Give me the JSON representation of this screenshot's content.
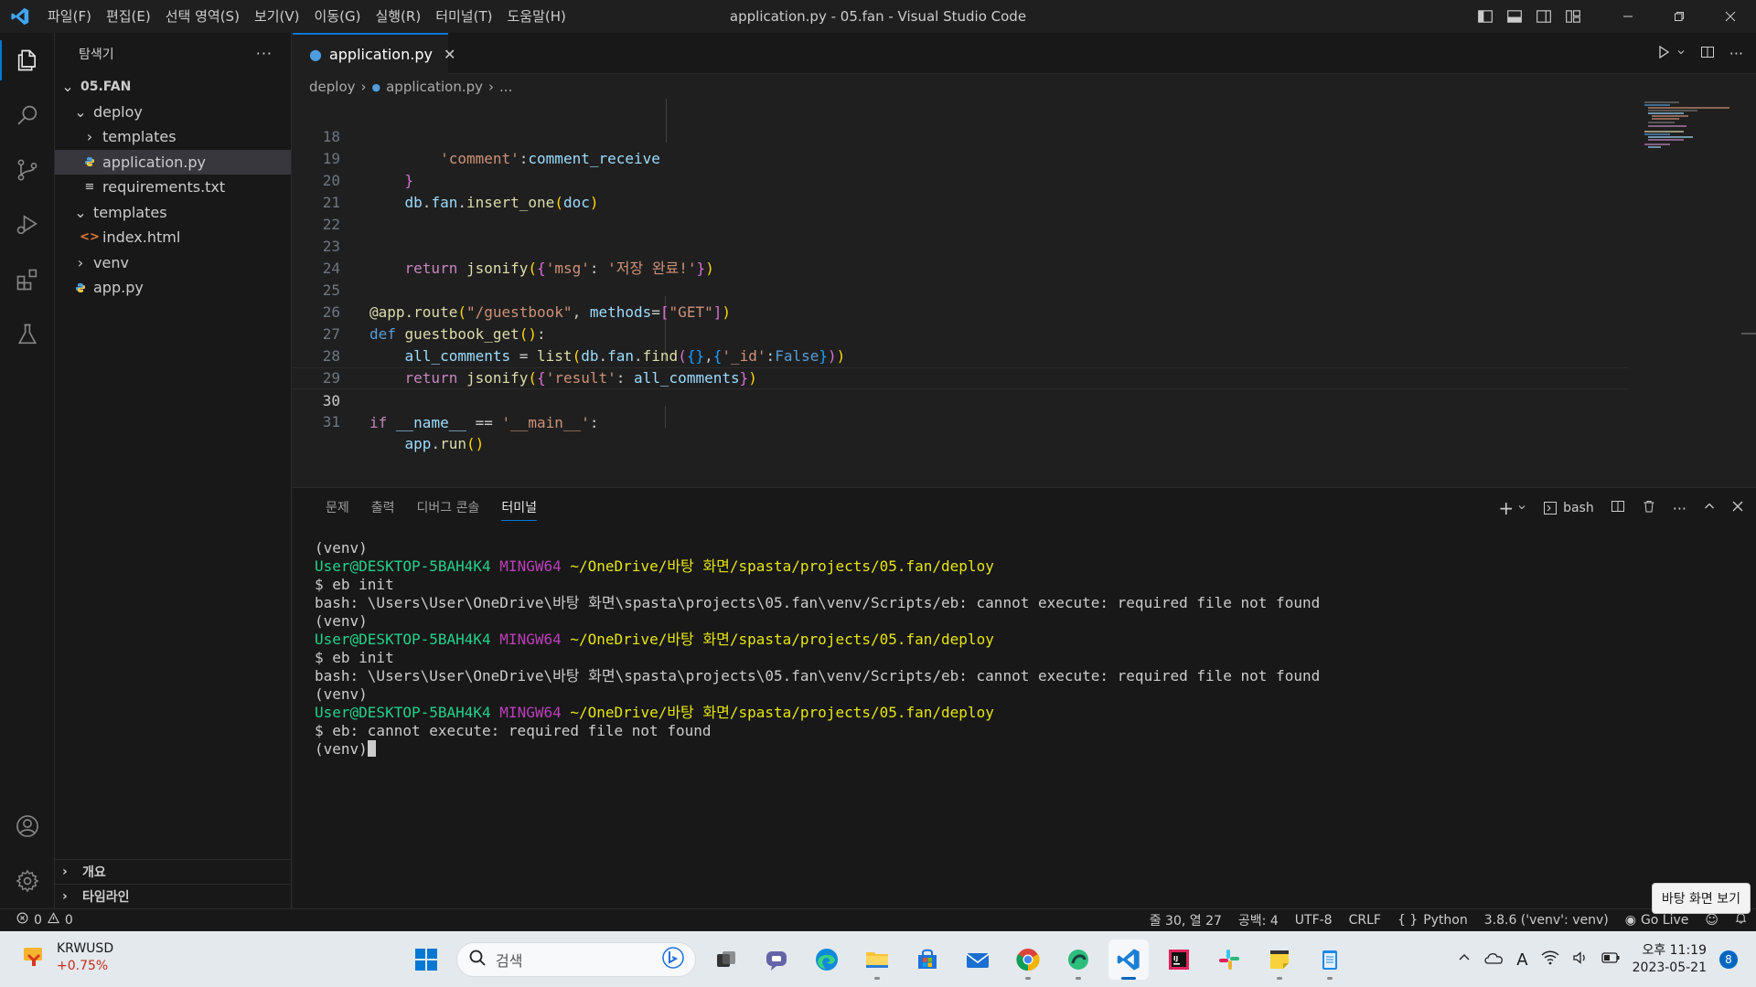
{
  "window": {
    "title": "application.py - 05.fan - Visual Studio Code",
    "menu": [
      "파일(F)",
      "편집(E)",
      "선택 영역(S)",
      "보기(V)",
      "이동(G)",
      "실행(R)",
      "터미널(T)",
      "도움말(H)"
    ]
  },
  "sidebar": {
    "title": "탐색기",
    "root": "05.FAN",
    "items": [
      {
        "label": "deploy",
        "kind": "folder-open",
        "depth": 1
      },
      {
        "label": "templates",
        "kind": "folder-closed",
        "depth": 2
      },
      {
        "label": "application.py",
        "kind": "python",
        "depth": 2
      },
      {
        "label": "requirements.txt",
        "kind": "text",
        "depth": 2
      },
      {
        "label": "templates",
        "kind": "folder-open",
        "depth": 1
      },
      {
        "label": "index.html",
        "kind": "html",
        "depth": 2
      },
      {
        "label": "venv",
        "kind": "folder-closed",
        "depth": 1
      },
      {
        "label": "app.py",
        "kind": "python",
        "depth": 1
      }
    ],
    "outline": "개요",
    "timeline": "타임라인"
  },
  "editor": {
    "tab_label": "application.py",
    "breadcrumb": [
      "deploy",
      "application.py",
      "..."
    ],
    "current_line": 30,
    "lines": [
      {
        "n": "18",
        "text": "'comment':comment_receive"
      },
      {
        "n": "19",
        "text": "}"
      },
      {
        "n": "20",
        "text": "db.fan.insert_one(doc)"
      },
      {
        "n": "21",
        "text": ""
      },
      {
        "n": "22",
        "text": ""
      },
      {
        "n": "23",
        "text": "return jsonify({'msg': '저장 완료!'})"
      },
      {
        "n": "24",
        "text": ""
      },
      {
        "n": "25",
        "text": "@app.route(\"/guestbook\", methods=[\"GET\"])"
      },
      {
        "n": "26",
        "text": "def guestbook_get():"
      },
      {
        "n": "27",
        "text": "all_comments = list(db.fan.find({},{'_id':False}))"
      },
      {
        "n": "28",
        "text": "return jsonify({'result': all_comments})"
      },
      {
        "n": "29",
        "text": ""
      },
      {
        "n": "30",
        "text": "if __name__ == '__main__':"
      },
      {
        "n": "31",
        "text": "app.run()"
      }
    ]
  },
  "panel": {
    "tabs": [
      "문제",
      "출력",
      "디버그 콘솔",
      "터미널"
    ],
    "active_tab": "터미널",
    "shell": "bash",
    "terminal": {
      "venv": "(venv)",
      "user": "User@DESKTOP-5BAH4K4",
      "ming": "MINGW64",
      "path": "~/OneDrive/바탕 화면/spasta/projects/05.fan/deploy",
      "cmd_init": "$ eb init",
      "error1": "bash: \\Users\\User\\OneDrive\\바탕 화면\\spasta\\projects\\05.fan\\venv/Scripts/eb: cannot execute: required file not found",
      "cmd_error": "$ eb: cannot execute: required file not found"
    }
  },
  "statusbar": {
    "errors": "0",
    "warnings": "0",
    "position": "줄 30, 열 27",
    "spaces": "공백: 4",
    "encoding": "UTF-8",
    "eol": "CRLF",
    "language": "Python",
    "interpreter": "3.8.6 ('venv': venv)",
    "golive": "Go Live"
  },
  "tooltip": "바탕 화면 보기",
  "taskbar": {
    "weather_title": "KRWUSD",
    "weather_change": "+0.75%",
    "search_placeholder": "검색",
    "time": "오후 11:19",
    "date": "2023-05-21",
    "notifications": "8"
  },
  "colors": {
    "accent": "#0078d4",
    "terminal_user": "#23d18b",
    "terminal_ming": "#bc3fbc",
    "terminal_path": "#e5e510"
  }
}
